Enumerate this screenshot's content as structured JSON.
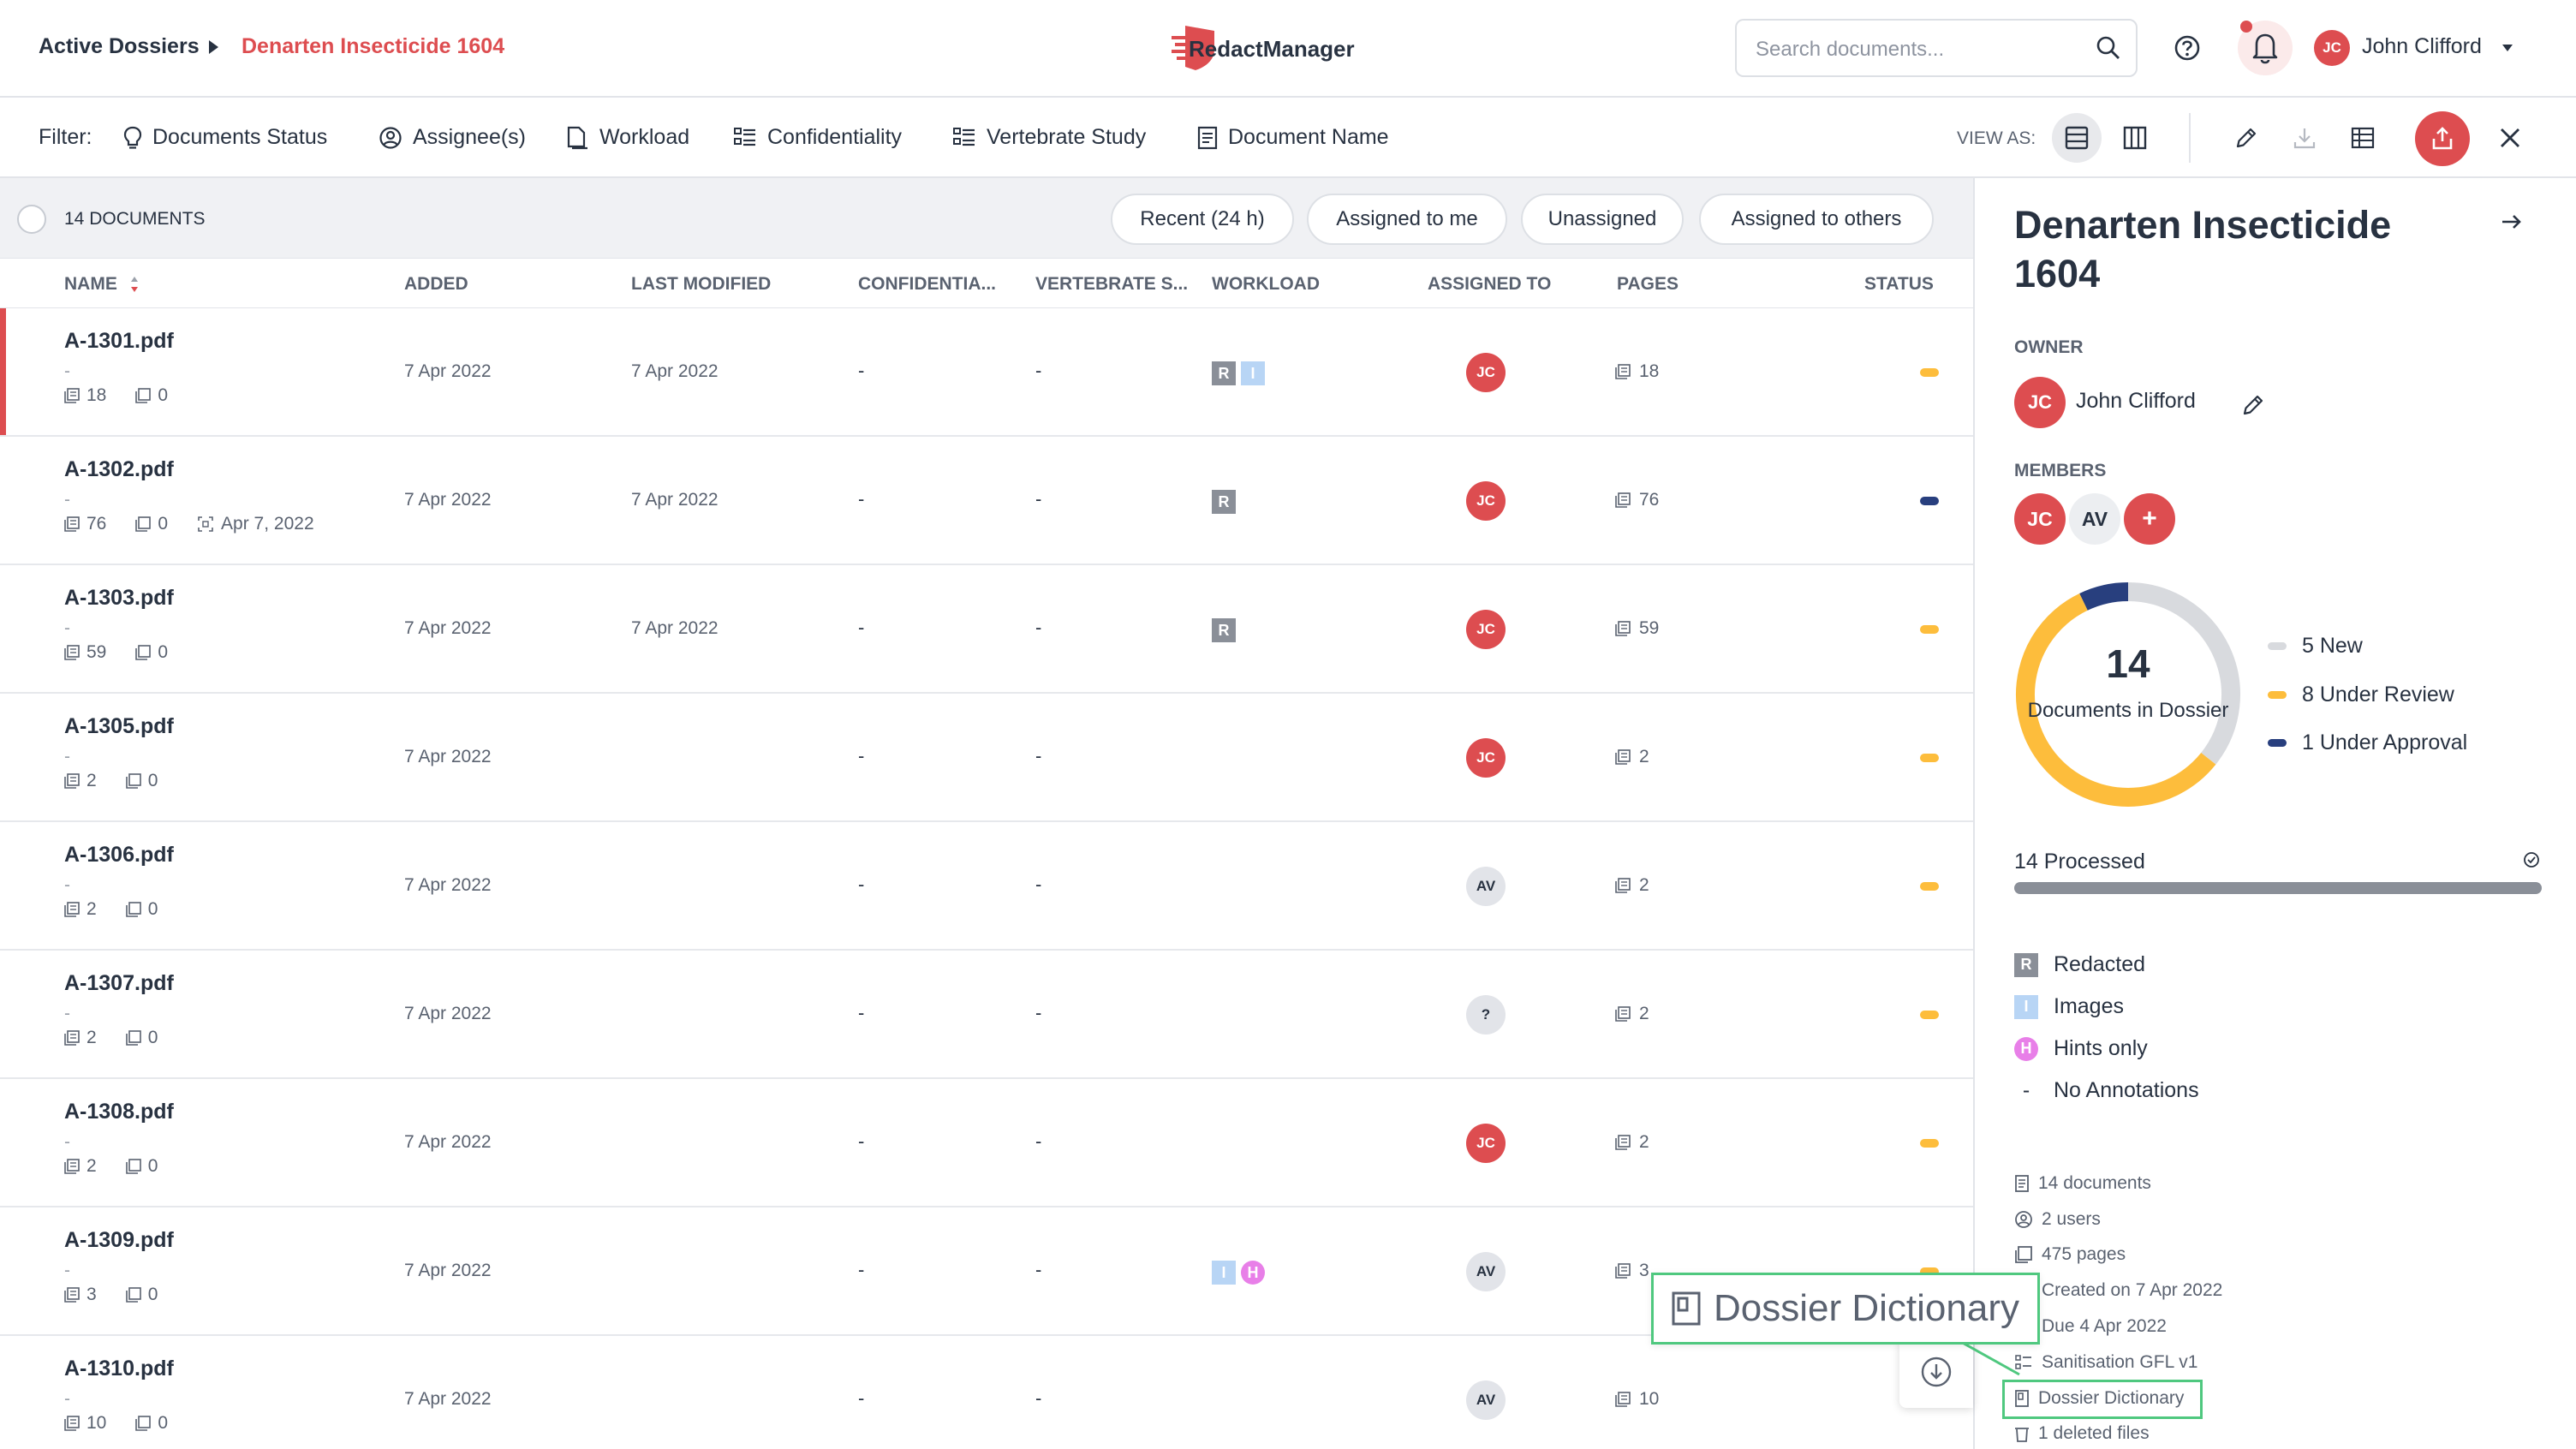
{
  "header": {
    "breadcrumb_root": "Active Dossiers",
    "breadcrumb_current": "Denarten Insecticide 1604",
    "app_name": "RedactManager",
    "search_placeholder": "Search documents...",
    "user_initials": "JC",
    "user_name": "John Clifford"
  },
  "filters": {
    "label": "Filter:",
    "items": [
      "Documents Status",
      "Assignee(s)",
      "Workload",
      "Confidentiality",
      "Vertebrate Study",
      "Document Name"
    ],
    "view_as_label": "VIEW AS:"
  },
  "list": {
    "doc_count_label": "14 DOCUMENTS",
    "quick_filters": [
      "Recent (24 h)",
      "Assigned to me",
      "Unassigned",
      "Assigned to others"
    ],
    "columns": [
      "NAME",
      "ADDED",
      "LAST MODIFIED",
      "CONFIDENTIA...",
      "VERTEBRATE S...",
      "WORKLOAD",
      "ASSIGNED TO",
      "PAGES",
      "STATUS"
    ],
    "rows": [
      {
        "name": "A-1301.pdf",
        "dash": "-",
        "pages_meta": "18",
        "anno_meta": "0",
        "extra": "",
        "added": "7 Apr 2022",
        "modified": "7 Apr 2022",
        "conf": "-",
        "vert": "-",
        "workload": [
          "R",
          "I"
        ],
        "assignee": "JC",
        "pages": "18",
        "status": "under-review"
      },
      {
        "name": "A-1302.pdf",
        "dash": "-",
        "pages_meta": "76",
        "anno_meta": "0",
        "extra": "Apr 7, 2022",
        "added": "7 Apr 2022",
        "modified": "7 Apr 2022",
        "conf": "-",
        "vert": "-",
        "workload": [
          "R"
        ],
        "assignee": "JC",
        "pages": "76",
        "status": "under-approval"
      },
      {
        "name": "A-1303.pdf",
        "dash": "-",
        "pages_meta": "59",
        "anno_meta": "0",
        "extra": "",
        "added": "7 Apr 2022",
        "modified": "7 Apr 2022",
        "conf": "-",
        "vert": "-",
        "workload": [
          "R"
        ],
        "assignee": "JC",
        "pages": "59",
        "status": "under-review"
      },
      {
        "name": "A-1305.pdf",
        "dash": "-",
        "pages_meta": "2",
        "anno_meta": "0",
        "extra": "",
        "added": "7 Apr 2022",
        "modified": "",
        "conf": "-",
        "vert": "-",
        "workload": [],
        "assignee": "JC",
        "pages": "2",
        "status": "under-review"
      },
      {
        "name": "A-1306.pdf",
        "dash": "-",
        "pages_meta": "2",
        "anno_meta": "0",
        "extra": "",
        "added": "7 Apr 2022",
        "modified": "",
        "conf": "-",
        "vert": "-",
        "workload": [],
        "assignee": "AV",
        "pages": "2",
        "status": "under-review"
      },
      {
        "name": "A-1307.pdf",
        "dash": "-",
        "pages_meta": "2",
        "anno_meta": "0",
        "extra": "",
        "added": "7 Apr 2022",
        "modified": "",
        "conf": "-",
        "vert": "-",
        "workload": [],
        "assignee": "?",
        "pages": "2",
        "status": "under-review"
      },
      {
        "name": "A-1308.pdf",
        "dash": "-",
        "pages_meta": "2",
        "anno_meta": "0",
        "extra": "",
        "added": "7 Apr 2022",
        "modified": "",
        "conf": "-",
        "vert": "-",
        "workload": [],
        "assignee": "JC",
        "pages": "2",
        "status": "under-review"
      },
      {
        "name": "A-1309.pdf",
        "dash": "-",
        "pages_meta": "3",
        "anno_meta": "0",
        "extra": "",
        "added": "7 Apr 2022",
        "modified": "",
        "conf": "-",
        "vert": "-",
        "workload": [
          "I",
          "H"
        ],
        "assignee": "AV",
        "pages": "3",
        "status": "under-review"
      },
      {
        "name": "A-1310.pdf",
        "dash": "-",
        "pages_meta": "10",
        "anno_meta": "0",
        "extra": "",
        "added": "7 Apr 2022",
        "modified": "",
        "conf": "-",
        "vert": "-",
        "workload": [],
        "assignee": "AV",
        "pages": "10",
        "status": "under-review"
      }
    ]
  },
  "sidepanel": {
    "title": "Denarten Insecticide 1604",
    "owner_label": "OWNER",
    "owner_initials": "JC",
    "owner_name": "John Clifford",
    "members_label": "MEMBERS",
    "members": [
      "JC",
      "AV",
      "+"
    ],
    "donut_count": "14",
    "donut_label": "Documents in Dossier",
    "legend": [
      {
        "label": "5 New",
        "value": 5,
        "color": "#d8dade"
      },
      {
        "label": "8 Under Review",
        "value": 8,
        "color": "#fdbd3c"
      },
      {
        "label": "1 Under Approval",
        "value": 1,
        "color": "#283f7e"
      }
    ],
    "processed_label": "14 Processed",
    "processed_fraction": 1.0,
    "key": [
      {
        "badge": "R",
        "label": "Redacted"
      },
      {
        "badge": "I",
        "label": "Images"
      },
      {
        "badge": "H",
        "label": "Hints only"
      },
      {
        "badge": "-",
        "label": "No Annotations"
      }
    ],
    "info": [
      "14 documents",
      "2 users",
      "475 pages",
      "Created on 7 Apr 2022",
      "Due 4 Apr 2022",
      "Sanitisation GFL v1",
      "Dossier Dictionary",
      "1 deleted files"
    ]
  },
  "tooltip": {
    "label": "Dossier Dictionary"
  },
  "colors": {
    "accent": "#dd4d50",
    "under_review": "#fdbd3c",
    "under_approval": "#283f7e",
    "new": "#d8dade"
  }
}
